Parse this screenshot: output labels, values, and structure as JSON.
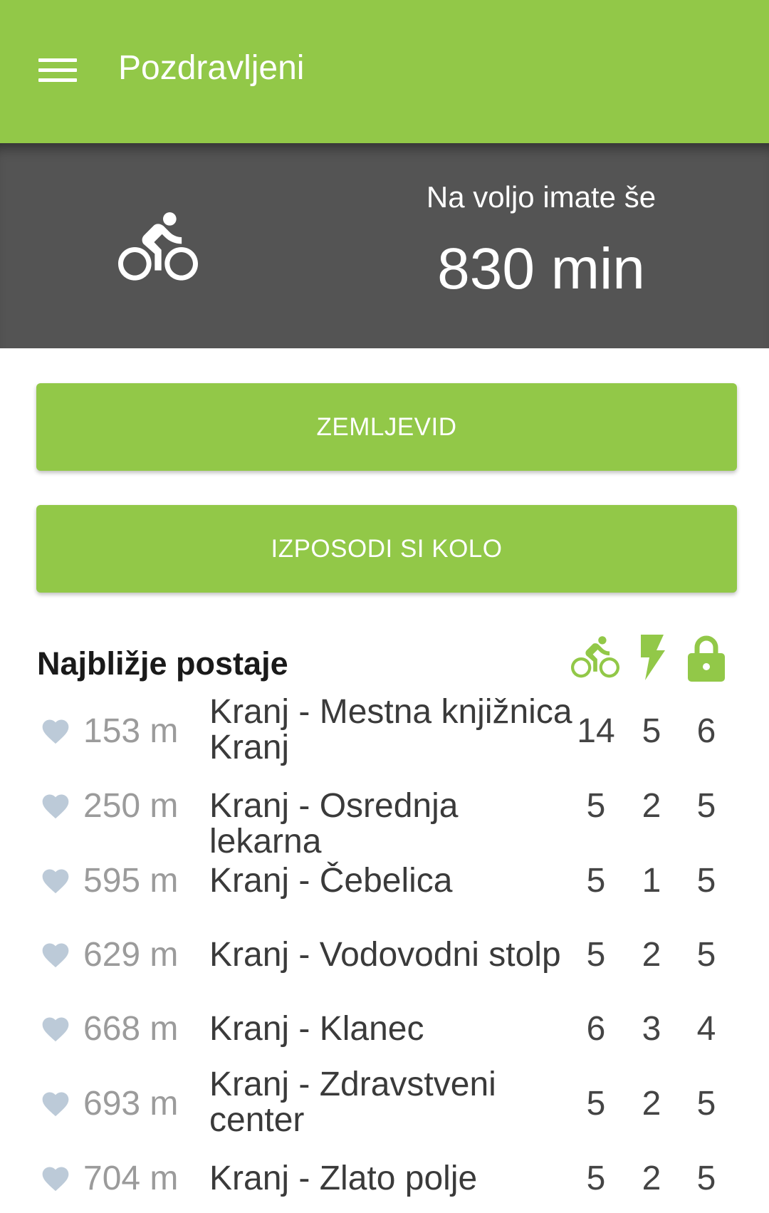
{
  "appbar": {
    "title": "Pozdravljeni"
  },
  "banner": {
    "label": "Na voljo imate še",
    "value": "830 min"
  },
  "buttons": {
    "map": "ZEMLJEVID",
    "rent": "IZPOSODI SI KOLO"
  },
  "section": {
    "title": "Najbližje postaje"
  },
  "columns": [
    "bike-icon",
    "bolt-icon",
    "lock-icon"
  ],
  "colors": {
    "primary": "#92c848",
    "banner": "#545454",
    "heart": "#bccad8"
  },
  "stations": [
    {
      "distance": "153 m",
      "name": "Kranj - Mestna knjižnica Kranj",
      "bikes": "14",
      "charging": "5",
      "free": "6"
    },
    {
      "distance": "250 m",
      "name": "Kranj - Osrednja lekarna",
      "bikes": "5",
      "charging": "2",
      "free": "5"
    },
    {
      "distance": "595 m",
      "name": "Kranj - Čebelica",
      "bikes": "5",
      "charging": "1",
      "free": "5"
    },
    {
      "distance": "629 m",
      "name": "Kranj - Vodovodni stolp",
      "bikes": "5",
      "charging": "2",
      "free": "5"
    },
    {
      "distance": "668 m",
      "name": "Kranj - Klanec",
      "bikes": "6",
      "charging": "3",
      "free": "4"
    },
    {
      "distance": "693 m",
      "name": "Kranj - Zdravstveni center",
      "bikes": "5",
      "charging": "2",
      "free": "5"
    },
    {
      "distance": "704 m",
      "name": "Kranj - Zlato polje",
      "bikes": "5",
      "charging": "2",
      "free": "5"
    }
  ]
}
